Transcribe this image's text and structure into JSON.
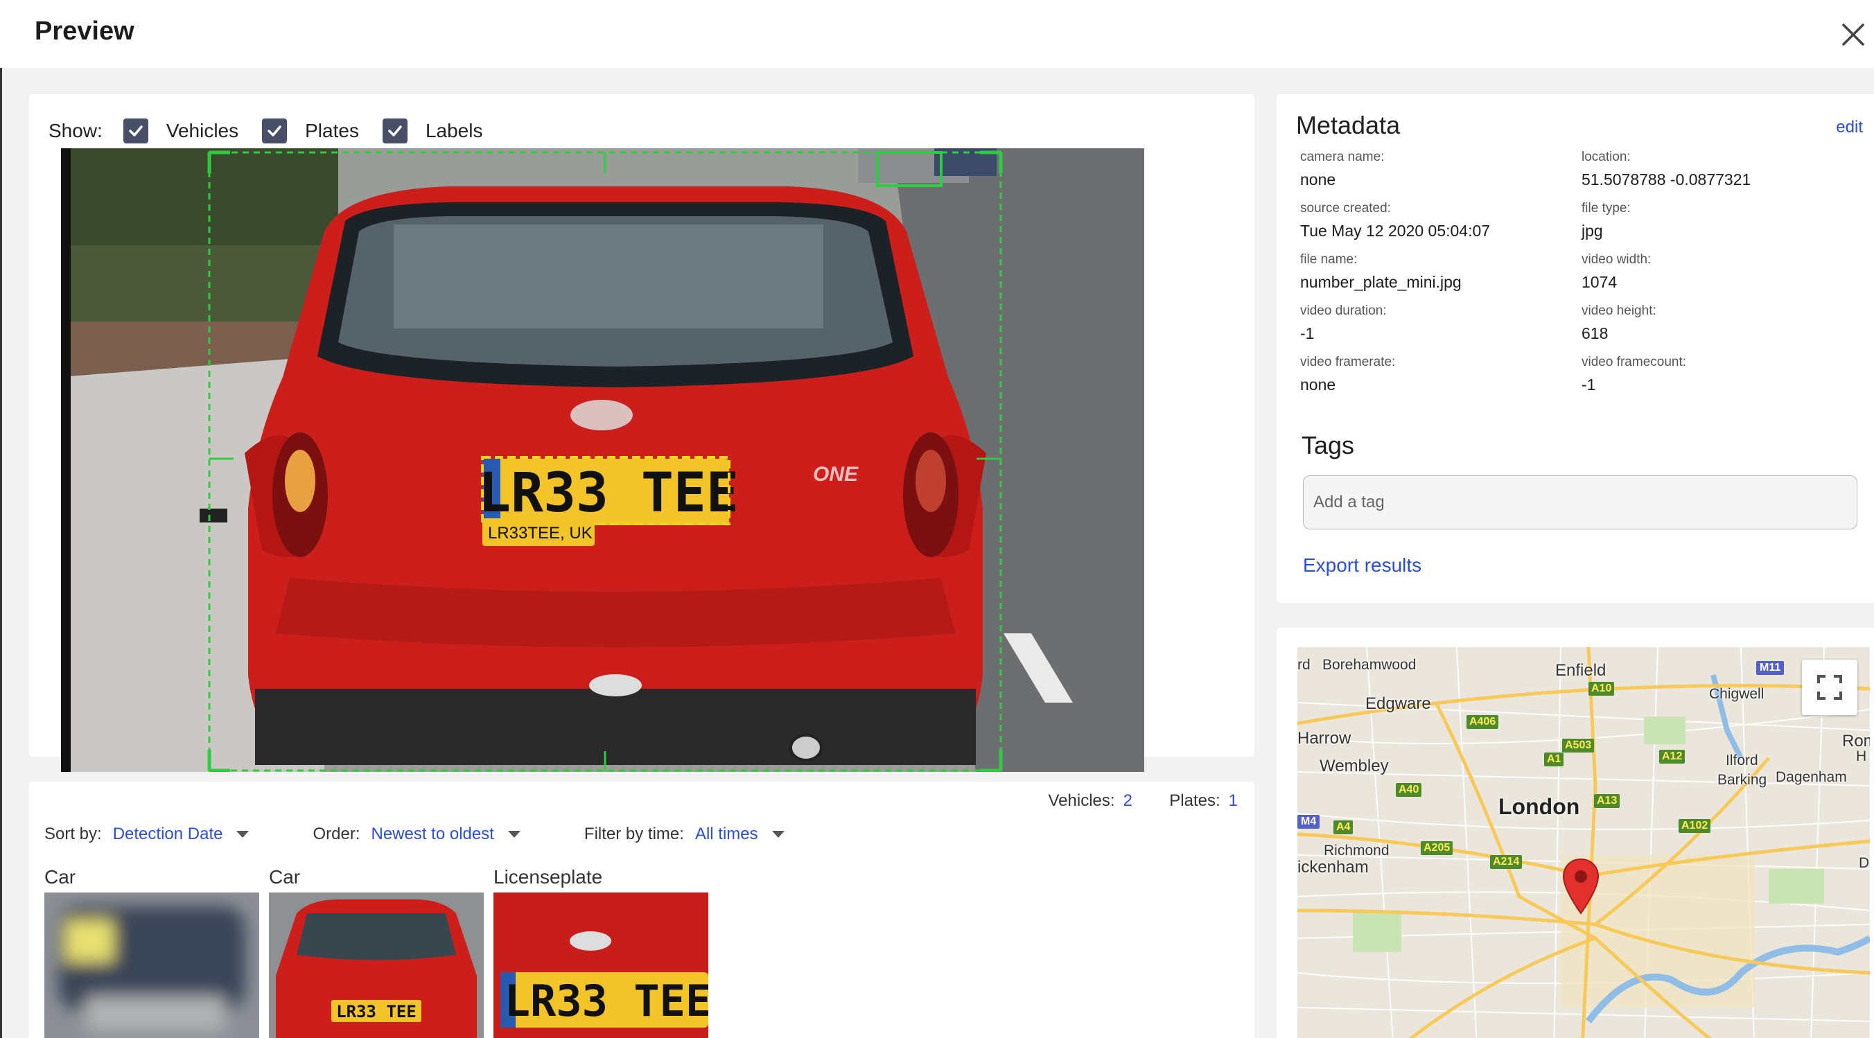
{
  "header": {
    "title": "Preview"
  },
  "show": {
    "label": "Show:",
    "options": [
      {
        "label": "Vehicles",
        "checked": true
      },
      {
        "label": "Plates",
        "checked": true
      },
      {
        "label": "Labels",
        "checked": true
      }
    ]
  },
  "preview": {
    "plate_text": "LR33 TEE",
    "plate_tag": "LR33TEE, UK",
    "badge_text": "ONE"
  },
  "detections": {
    "vehicles_label": "Vehicles:",
    "vehicles_count": "2",
    "plates_label": "Plates:",
    "plates_count": "1",
    "sort_label": "Sort by:",
    "sort_value": "Detection Date",
    "order_label": "Order:",
    "order_value": "Newest to oldest",
    "filter_label": "Filter by time:",
    "filter_value": "All times",
    "thumbs": [
      {
        "label": "Car"
      },
      {
        "label": "Car",
        "plate": "LR33 TEE"
      },
      {
        "label": "Licenseplate",
        "plate": "LR33 TEE"
      }
    ]
  },
  "metadata": {
    "title": "Metadata",
    "edit": "edit",
    "fields": [
      {
        "key": "camera name:",
        "value": "none"
      },
      {
        "key": "location:",
        "value": "51.5078788 -0.0877321"
      },
      {
        "key": "source created:",
        "value": "Tue May 12 2020 05:04:07"
      },
      {
        "key": "file type:",
        "value": "jpg"
      },
      {
        "key": "file name:",
        "value": "number_plate_mini.jpg"
      },
      {
        "key": "video width:",
        "value": "1074"
      },
      {
        "key": "video duration:",
        "value": "-1"
      },
      {
        "key": "video height:",
        "value": "618"
      },
      {
        "key": "video framerate:",
        "value": "none"
      },
      {
        "key": "video framecount:",
        "value": "-1"
      }
    ],
    "tags_title": "Tags",
    "tag_placeholder": "Add a tag",
    "export": "Export results"
  },
  "map": {
    "places": {
      "rd": "rd",
      "borehamwood": "Borehamwood",
      "enfield": "Enfield",
      "edgware": "Edgware",
      "chigwell": "Chigwell",
      "harrow": "Harrow",
      "romford": "Romf",
      "h": "H",
      "wembley": "Wembley",
      "ilford": "Ilford",
      "barking": "Barking",
      "dagenham": "Dagenham",
      "london": "London",
      "richmond": "Richmond",
      "twickenham": "ickenham",
      "d": "D"
    },
    "roads": {
      "m11": "M11",
      "a10": "A10",
      "a406": "A406",
      "a503": "A503",
      "a12": "A12",
      "a1": "A1",
      "a40": "A40",
      "a13": "A13",
      "m4": "M4",
      "a4": "A4",
      "a102": "A102",
      "a205": "A205",
      "a214": "A214"
    }
  }
}
